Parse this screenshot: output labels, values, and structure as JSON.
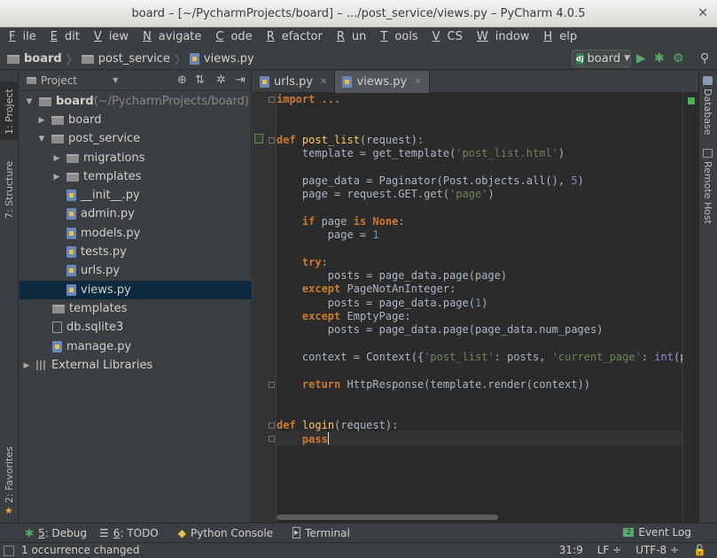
{
  "window": {
    "title": "board – [~/PycharmProjects/board] – .../post_service/views.py – PyCharm 4.0.5",
    "close_glyph": "✕"
  },
  "menu": [
    {
      "u": "F",
      "rest": "ile"
    },
    {
      "u": "E",
      "rest": "dit"
    },
    {
      "u": "V",
      "rest": "iew"
    },
    {
      "u": "N",
      "rest": "avigate"
    },
    {
      "u": "C",
      "rest": "ode"
    },
    {
      "u": "R",
      "rest": "efactor"
    },
    {
      "u": "R",
      "rest": "un"
    },
    {
      "u": "T",
      "rest": "ools"
    },
    {
      "u": "V",
      "rest": "CS"
    },
    {
      "u": "W",
      "rest": "indow"
    },
    {
      "u": "H",
      "rest": "elp"
    }
  ],
  "breadcrumb": {
    "root": "board",
    "folder": "post_service",
    "file": "views.py"
  },
  "run_config": {
    "badge": "dj",
    "label": "board"
  },
  "left_tabs": {
    "project": "1: Project",
    "structure": "7: Structure",
    "favorites": "2: Favorites"
  },
  "right_tabs": {
    "database": "Database",
    "remote_host": "Remote Host"
  },
  "project_panel": {
    "view_label": "Project",
    "tree": [
      {
        "label": "board",
        "suffix": " (~/PycharmProjects/board)",
        "bold": true
      },
      {
        "label": "board"
      },
      {
        "label": "post_service"
      },
      {
        "label": "migrations"
      },
      {
        "label": "templates"
      },
      {
        "label": "__init__.py"
      },
      {
        "label": "admin.py"
      },
      {
        "label": "models.py"
      },
      {
        "label": "tests.py"
      },
      {
        "label": "urls.py"
      },
      {
        "label": "views.py"
      },
      {
        "label": "templates"
      },
      {
        "label": "db.sqlite3"
      },
      {
        "label": "manage.py"
      },
      {
        "label": "External Libraries"
      }
    ]
  },
  "editor_tabs": [
    {
      "label": "urls.py"
    },
    {
      "label": "views.py"
    }
  ],
  "code": {
    "import": "import ...",
    "def": "def",
    "post_list_fn": "post_list",
    "post_list_args": "(request):",
    "l_template": "    template = get_template(",
    "s_post_list_html": "'post_list.html'",
    "l_page_data_a": "    page_data = Paginator(Post.objects.all(), ",
    "n_5": "5",
    "l_page_a": "    page = request.GET.get(",
    "s_page": "'page'",
    "kw_if": "if",
    "l_if_mid": " page ",
    "kw_is": "is",
    "kw_none": "None",
    "l_page_eq": "        page = ",
    "n_1": "1",
    "kw_try": "try",
    "l_posts_page": "        posts = page_data.page(page)",
    "kw_except": "except",
    "l_pnai": " PageNotAnInteger:",
    "l_posts_1a": "        posts = page_data.page(",
    "l_empty": " EmptyPage:",
    "l_posts_num": "        posts = page_data.page(page_data.num_pages)",
    "l_context_a": "    context = Context({",
    "s_post_list": "'post_list'",
    "l_context_b": ": posts, ",
    "s_current_page": "'current_page'",
    "l_context_c": ": ",
    "bi_int": "int",
    "l_context_d": "(page)",
    "kw_return": "return",
    "l_return_rest": " HttpResponse(template.render(context))",
    "login_fn": "login",
    "login_args": "(request):",
    "kw_pass": "pass",
    "colon": ":",
    "rparen": ")"
  },
  "bottom_tools": [
    {
      "num": "5",
      "label": ": Debug"
    },
    {
      "num": "6",
      "label": ": TODO"
    },
    {
      "label": "Python Console"
    },
    {
      "label": "Terminal"
    }
  ],
  "event_log": "Event Log",
  "event_log_count": "2",
  "status": {
    "message": "1 occurrence changed",
    "position": "31:9",
    "line_sep": "LF ÷",
    "encoding": "UTF-8 ÷"
  }
}
